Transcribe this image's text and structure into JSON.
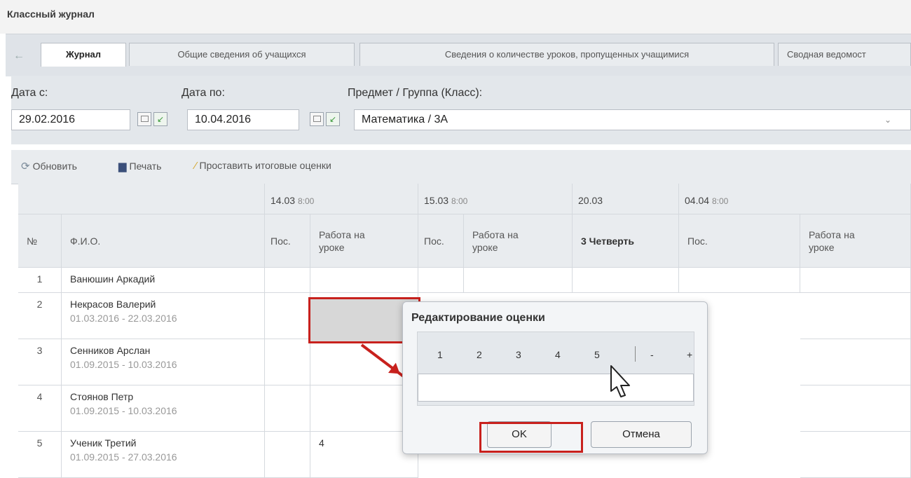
{
  "window": {
    "title": "Классный журнал"
  },
  "tabs": [
    {
      "label": "Журнал",
      "active": true
    },
    {
      "label": "Общие сведения об учащихся"
    },
    {
      "label": "Сведения о количестве уроков, пропущенных учащимися"
    },
    {
      "label": "Сводная ведомост"
    }
  ],
  "filters": {
    "date_from_label": "Дата с:",
    "date_from_value": "29.02.2016",
    "date_to_label": "Дата по:",
    "date_to_value": "10.04.2016",
    "subject_label": "Предмет / Группа (Класс):",
    "subject_value": "Математика / 3А"
  },
  "toolbar": {
    "refresh_label": "Обновить",
    "print_label": "Печать",
    "final_grades_label": "Проставить итоговые оценки"
  },
  "table": {
    "dates": [
      {
        "date": "14.03",
        "time": "8:00"
      },
      {
        "date": "15.03",
        "time": "8:00"
      },
      {
        "date": "20.03",
        "time": ""
      },
      {
        "date": "04.04",
        "time": "8:00"
      }
    ],
    "headers": {
      "num": "№",
      "name": "Ф.И.О.",
      "pos": "Пос.",
      "work": "Работа на уроке",
      "quarter": "3 Четверть"
    },
    "rows": [
      {
        "num": "1",
        "name": "Ванюшин Аркадий",
        "dates": "",
        "grade": ""
      },
      {
        "num": "2",
        "name": "Некрасов Валерий",
        "dates": "01.03.2016 - 22.03.2016",
        "grade": ""
      },
      {
        "num": "3",
        "name": "Сенников Арслан",
        "dates": "01.09.2015 - 10.03.2016",
        "grade": ""
      },
      {
        "num": "4",
        "name": "Стоянов Петр",
        "dates": "01.09.2015 - 10.03.2016",
        "grade": ""
      },
      {
        "num": "5",
        "name": "Ученик Третий",
        "dates": "01.09.2015 - 27.03.2016",
        "grade": "4"
      }
    ]
  },
  "dialog": {
    "title": "Редактирование оценки",
    "grade_options": [
      "1",
      "2",
      "3",
      "4",
      "5",
      "-",
      "+"
    ],
    "input_value": "",
    "ok_label": "OK",
    "cancel_label": "Отмена"
  },
  "colors": {
    "highlight": "#c8211d"
  },
  "icons": [
    "back-arrow-icon",
    "calendar-icon",
    "refresh-icon",
    "printer-icon",
    "wand-icon",
    "dropdown-arrow-icon",
    "mouse-pointer-icon"
  ]
}
